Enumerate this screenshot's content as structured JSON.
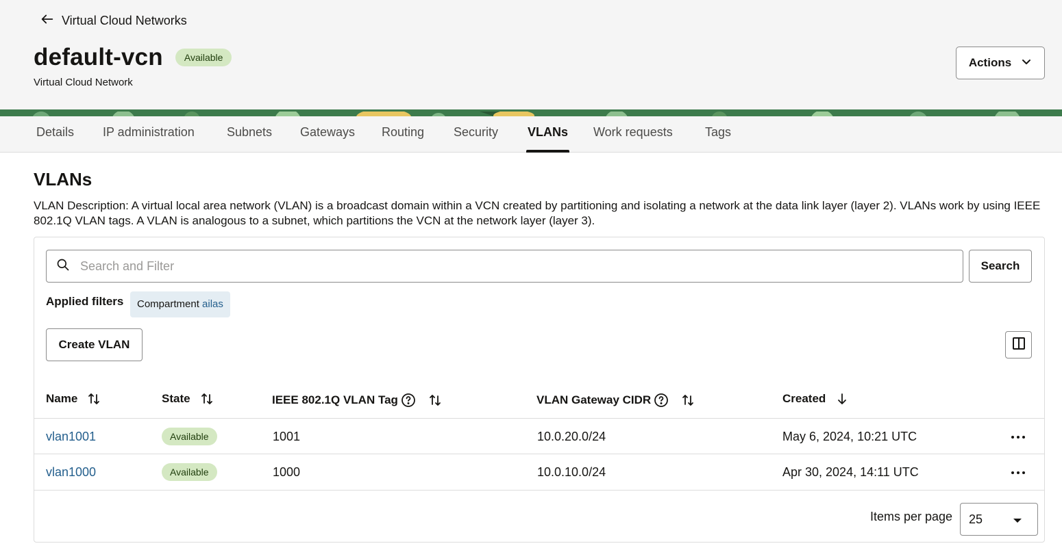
{
  "header": {
    "back_label": "Virtual Cloud Networks",
    "title": "default-vcn",
    "status": "Available",
    "subtitle": "Virtual Cloud Network",
    "actions_label": "Actions"
  },
  "tabs": [
    {
      "label": "Details"
    },
    {
      "label": "IP administration"
    },
    {
      "label": "Subnets"
    },
    {
      "label": "Gateways"
    },
    {
      "label": "Routing"
    },
    {
      "label": "Security"
    },
    {
      "label": "VLANs",
      "active": true
    },
    {
      "label": "Work requests"
    },
    {
      "label": "Tags"
    }
  ],
  "section": {
    "title": "VLANs",
    "description": "VLAN Description: A virtual local area network (VLAN) is a broadcast domain within a VCN created by partitioning and isolating a network at the data link layer (layer 2). VLANs work by using IEEE 802.1Q VLAN tags. A VLAN is analogous to a subnet, which partitions the VCN at the network layer (layer 3)."
  },
  "search": {
    "placeholder": "Search and Filter",
    "value": "",
    "button_label": "Search"
  },
  "filters": {
    "label": "Applied filters",
    "chips": [
      {
        "key": "Compartment",
        "value": "ailas"
      }
    ]
  },
  "create_button_label": "Create VLAN",
  "table": {
    "columns": [
      {
        "label": "Name",
        "sort": "both"
      },
      {
        "label": "State",
        "sort": "both"
      },
      {
        "label": "IEEE 802.1Q VLAN Tag",
        "sort": "both",
        "help": true
      },
      {
        "label": "VLAN Gateway CIDR",
        "sort": "both",
        "help": true
      },
      {
        "label": "Created",
        "sort": "desc"
      }
    ],
    "rows": [
      {
        "name": "vlan1001",
        "state": "Available",
        "tag": "1001",
        "cidr": "10.0.20.0/24",
        "created": "May 6, 2024, 10:21 UTC"
      },
      {
        "name": "vlan1000",
        "state": "Available",
        "tag": "1000",
        "cidr": "10.0.10.0/24",
        "created": "Apr 30, 2024, 14:11 UTC"
      }
    ]
  },
  "pagination": {
    "items_per_page_label": "Items per page",
    "items_per_page": "25"
  },
  "colors": {
    "link": "#245f8d",
    "status_bg": "#d4e8c2",
    "chip_bg": "#e4edf3",
    "banner": "#3d7b4c"
  }
}
